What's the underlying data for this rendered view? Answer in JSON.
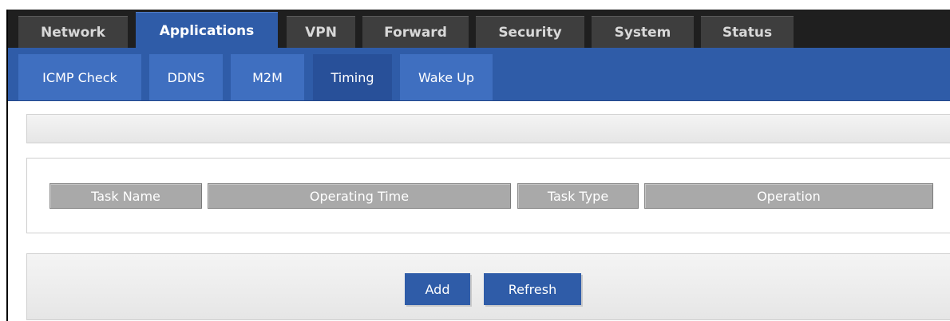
{
  "main_nav": {
    "tabs": [
      {
        "label": "Network"
      },
      {
        "label": "Applications"
      },
      {
        "label": "VPN"
      },
      {
        "label": "Forward"
      },
      {
        "label": "Security"
      },
      {
        "label": "System"
      },
      {
        "label": "Status"
      }
    ],
    "active": "Applications"
  },
  "sub_nav": {
    "tabs": [
      {
        "label": "ICMP Check"
      },
      {
        "label": "DDNS"
      },
      {
        "label": "M2M"
      },
      {
        "label": "Timing"
      },
      {
        "label": "Wake Up"
      }
    ],
    "active": "Timing"
  },
  "task_table": {
    "columns": [
      "Task Name",
      "Operating Time",
      "Task Type",
      "Operation"
    ],
    "rows": []
  },
  "actions": {
    "add_label": "Add",
    "refresh_label": "Refresh"
  },
  "colors": {
    "accent_blue": "#2f5ca8",
    "nav_dark": "#1f1f1f",
    "header_gray": "#a9a9a9"
  }
}
